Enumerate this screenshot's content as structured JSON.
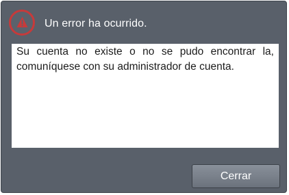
{
  "dialog": {
    "icon": "warning-icon",
    "accent_color": "#c73a3a",
    "title": "Un error ha ocurrido.",
    "message": "Su cuenta no existe o no se pudo encontrar la, comuníquese con su administrador de cuenta.",
    "close_label": "Cerrar"
  }
}
